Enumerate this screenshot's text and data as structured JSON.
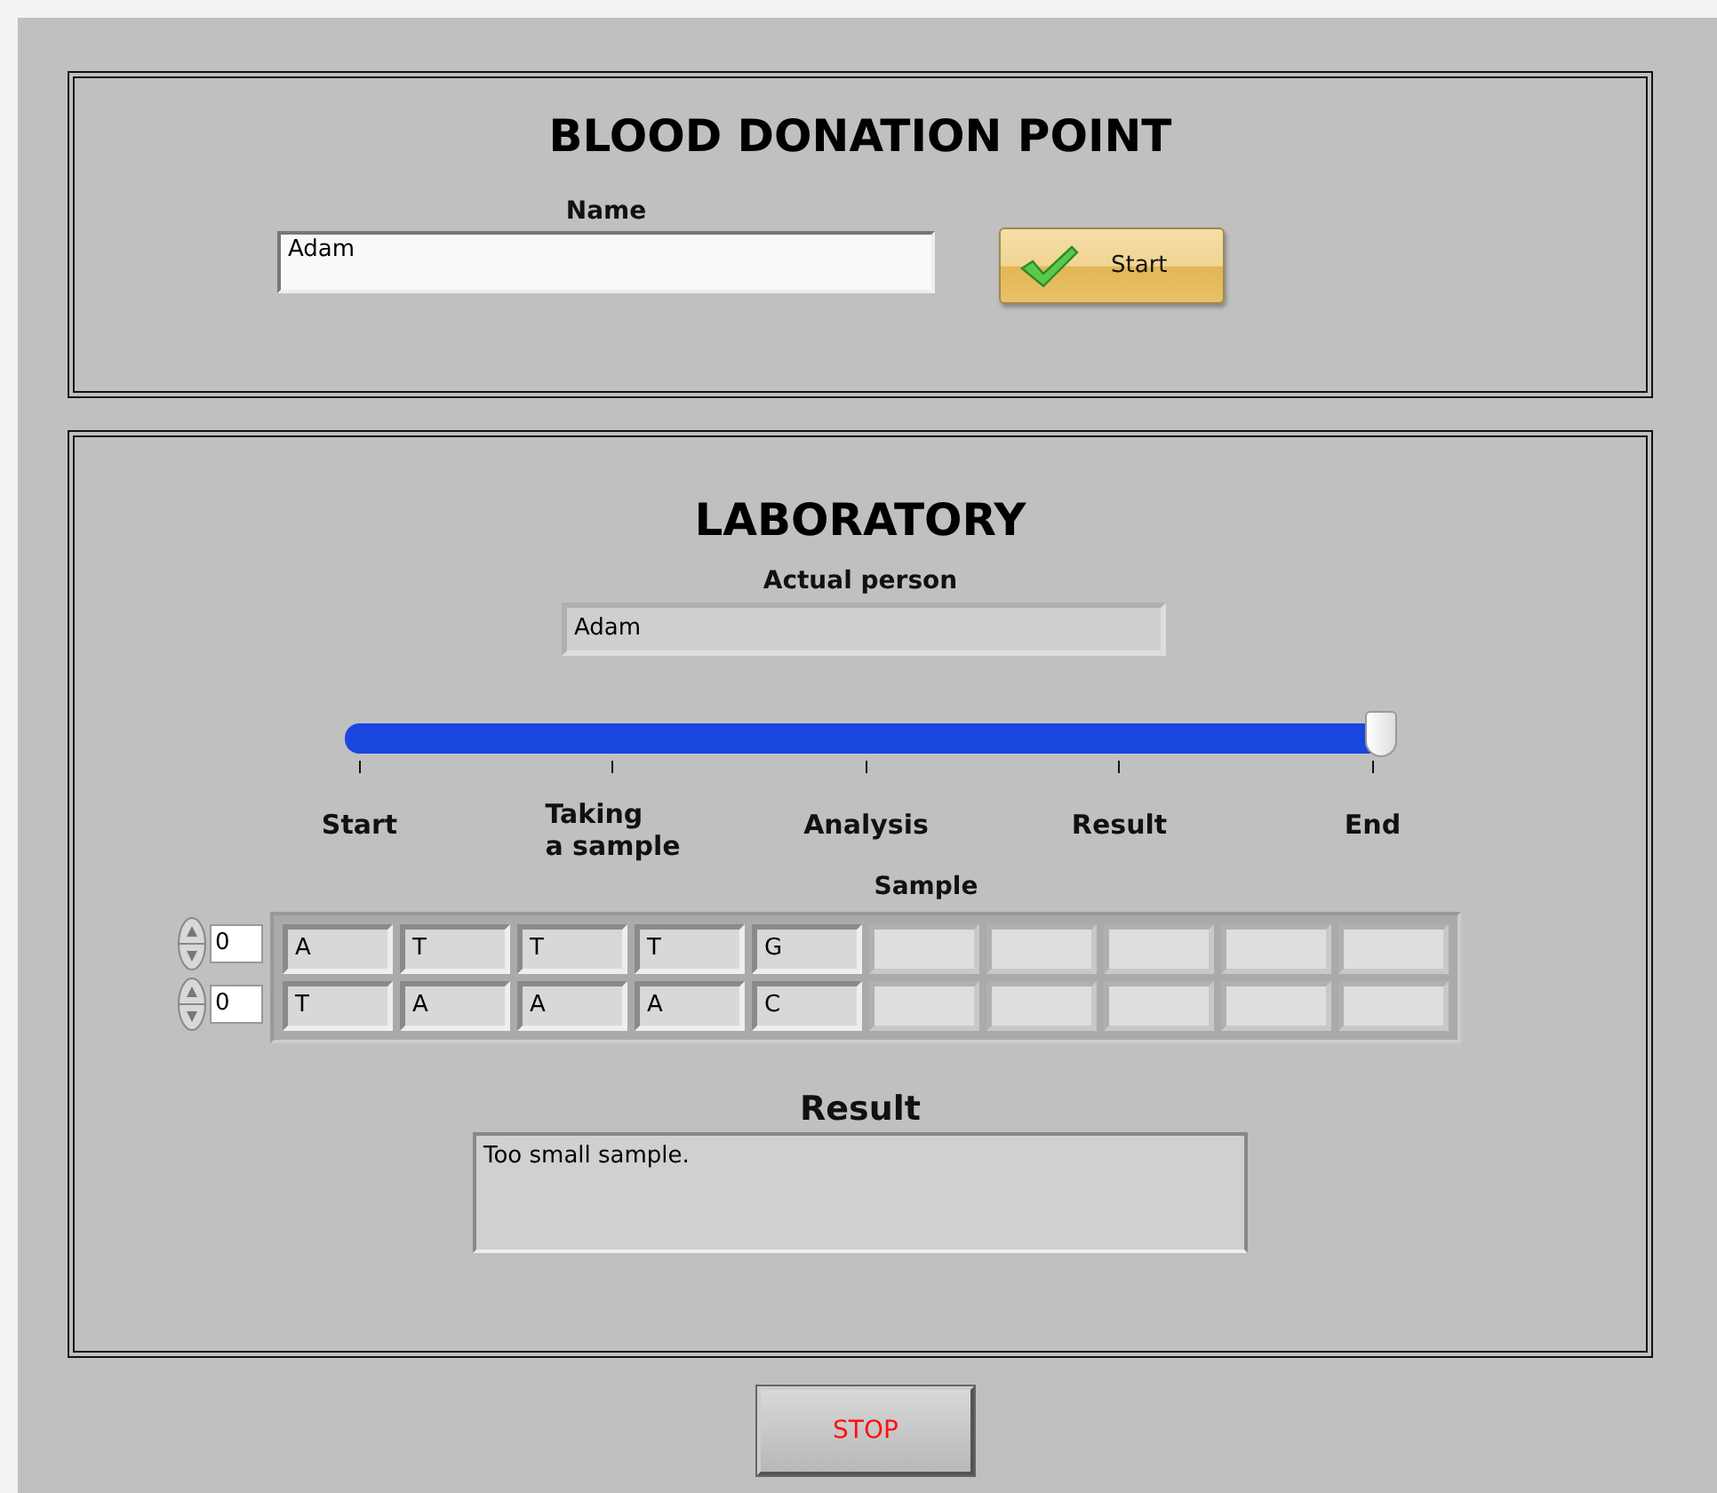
{
  "donation_point": {
    "title": "BLOOD DONATION POINT",
    "name_label": "Name",
    "name_value": "Adam",
    "start_button": "Start"
  },
  "laboratory": {
    "title": "LABORATORY",
    "actual_person_label": "Actual person",
    "actual_person_value": "Adam",
    "progress": {
      "level": 1,
      "scale_labels": [
        "Start",
        "Taking\na sample",
        "Analysis",
        "Result",
        "End"
      ]
    },
    "sample": {
      "label": "Sample",
      "rows": [
        {
          "index": "0",
          "cells": [
            "A",
            "T",
            "T",
            "T",
            "G"
          ]
        },
        {
          "index": "0",
          "cells": [
            "T",
            "A",
            "A",
            "A",
            "C"
          ]
        }
      ]
    },
    "result": {
      "label": "Result",
      "text": "Too small sample."
    }
  },
  "stop_button": "STOP"
}
